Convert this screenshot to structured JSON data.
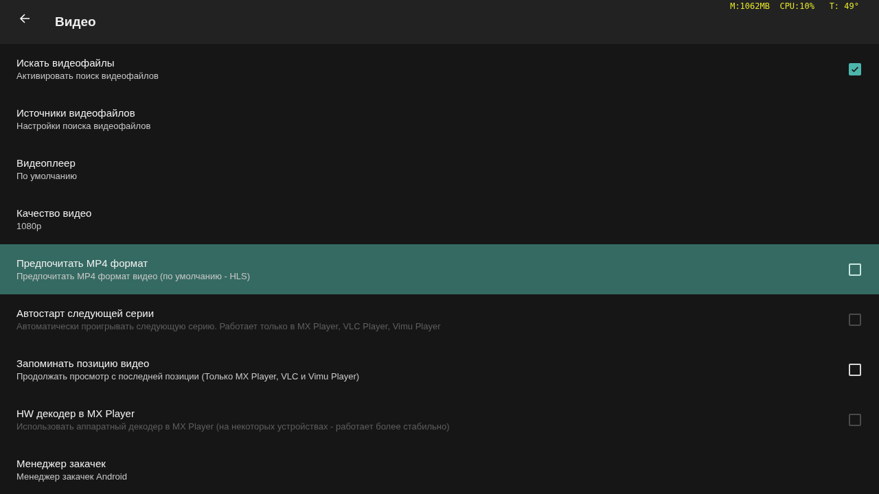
{
  "header": {
    "title": "Видео",
    "stats": "M:1062MB  CPU:10%   T: 49°"
  },
  "items": [
    {
      "kind": "checkbox",
      "title": "Искать видеофайлы",
      "summary": "Активировать поиск видеофайлов",
      "checked": true,
      "disabled": false,
      "selected": false
    },
    {
      "kind": "link",
      "title": "Источники видеофайлов",
      "summary": "Настройки поиска видеофайлов",
      "disabled": false,
      "selected": false
    },
    {
      "kind": "link",
      "title": "Видеоплеер",
      "summary": "По умолчанию",
      "disabled": false,
      "selected": false
    },
    {
      "kind": "link",
      "title": "Качество видео",
      "summary": "1080p",
      "disabled": false,
      "selected": false
    },
    {
      "kind": "checkbox",
      "title": "Предпочитать MP4 формат",
      "summary": "Предпочитать MP4 формат видео (по умолчанию - HLS)",
      "checked": false,
      "disabled": false,
      "selected": true
    },
    {
      "kind": "checkbox",
      "title": "Автостарт следующей серии",
      "summary": "Автоматически проигрывать следующую серию. Работает только в MX Player, VLC Player, Vimu Player",
      "checked": false,
      "disabled": true,
      "selected": false
    },
    {
      "kind": "checkbox",
      "title": "Запоминать позицию видео",
      "summary": "Продолжать просмотр с последней позиции (Только MX Player, VLC и Vimu Player)",
      "checked": false,
      "disabled": false,
      "selected": false
    },
    {
      "kind": "checkbox",
      "title": "HW декодер в MX Player",
      "summary": "Использовать аппаратный декодер в MX Player (на некоторых устройствах - работает более стабильно)",
      "checked": false,
      "disabled": true,
      "selected": false
    },
    {
      "kind": "link",
      "title": "Менеджер закачек",
      "summary": "Менеджер закачек Android",
      "disabled": false,
      "selected": false
    }
  ]
}
